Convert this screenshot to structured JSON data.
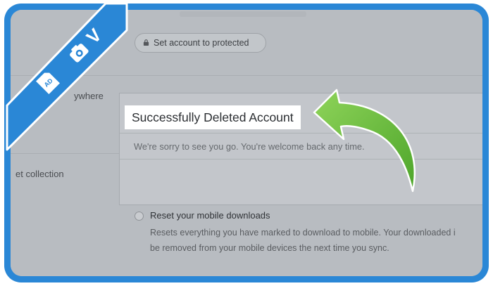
{
  "page": {
    "protect_button_label": "Set account to protected",
    "side_label_1": "ywhere",
    "side_label_2": "et collection"
  },
  "modal": {
    "title": "Successfully Deleted Account",
    "message": "We're sorry to see you go. You're welcome back any time."
  },
  "reset_option": {
    "title": "Reset your mobile downloads",
    "description_line1": "Resets everything you have marked to download to mobile. Your downloaded i",
    "description_line2": "be removed from your mobile devices the next time you sync."
  },
  "ribbon": {
    "icon_names": [
      "sd-card-icon",
      "camera-icon"
    ],
    "letter": "V",
    "sd_label": "AD"
  },
  "colors": {
    "frame_blue": "#2a87d6",
    "arrow_green": "#6fc13a",
    "ribbon_blue": "#2a87d6"
  }
}
